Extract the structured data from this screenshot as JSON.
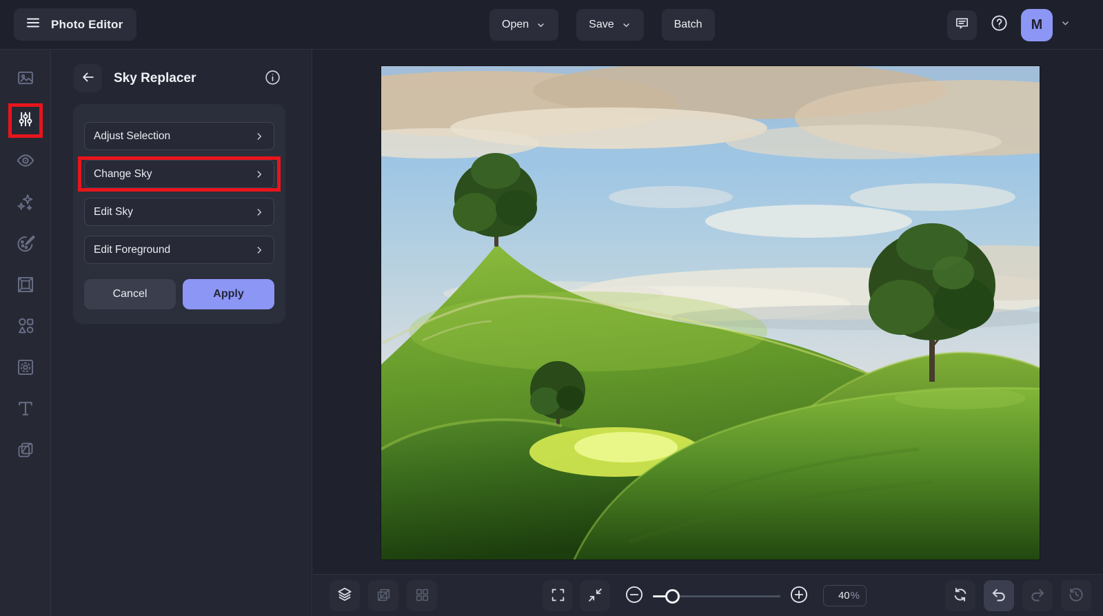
{
  "app": {
    "name": "Photo Editor"
  },
  "header": {
    "title": "Photo Editor",
    "menu_icon": "hamburger-icon",
    "open_label": "Open",
    "save_label": "Save",
    "batch_label": "Batch",
    "feedback_icon": "feedback-icon",
    "help_icon": "help-icon",
    "avatar_initial": "M",
    "account_caret_icon": "chevron-down-icon"
  },
  "sidebar": {
    "tools": [
      {
        "name": "photos",
        "icon": "image-icon",
        "active": false,
        "annotated": false
      },
      {
        "name": "adjustments",
        "icon": "sliders-icon",
        "active": true,
        "annotated": true
      },
      {
        "name": "preview",
        "icon": "eye-icon",
        "active": false,
        "annotated": false
      },
      {
        "name": "effects",
        "icon": "sparkles-icon",
        "active": false,
        "annotated": false
      },
      {
        "name": "color",
        "icon": "palette-icon",
        "active": false,
        "annotated": false
      },
      {
        "name": "frame",
        "icon": "frame-icon",
        "active": false,
        "annotated": false
      },
      {
        "name": "shapes",
        "icon": "shapes-icon",
        "active": false,
        "annotated": false
      },
      {
        "name": "mask",
        "icon": "mask-icon",
        "active": false,
        "annotated": false
      },
      {
        "name": "text",
        "icon": "text-icon",
        "active": false,
        "annotated": false
      },
      {
        "name": "blend",
        "icon": "blend-icon",
        "active": false,
        "annotated": false
      }
    ]
  },
  "panel": {
    "back_icon": "arrow-left-icon",
    "title": "Sky Replacer",
    "info_icon": "info-icon",
    "options": [
      {
        "label": "Adjust Selection",
        "annotated": false
      },
      {
        "label": "Change Sky",
        "annotated": true
      },
      {
        "label": "Edit Sky",
        "annotated": false
      },
      {
        "label": "Edit Foreground",
        "annotated": false
      }
    ],
    "cancel_label": "Cancel",
    "apply_label": "Apply"
  },
  "toolbar": {
    "left_tools": [
      {
        "name": "layers",
        "icon": "layers-icon",
        "enabled": true
      },
      {
        "name": "compare",
        "icon": "compare-icon",
        "enabled": false
      },
      {
        "name": "grid",
        "icon": "grid-icon",
        "enabled": false
      }
    ],
    "view_tools": [
      {
        "name": "fullscreen",
        "icon": "fullscreen-icon"
      },
      {
        "name": "fit-screen",
        "icon": "fit-screen-icon"
      }
    ],
    "zoom_out_icon": "minus-circle-icon",
    "zoom_in_icon": "plus-circle-icon",
    "slider_position_percent": 15,
    "zoom_value": "40",
    "zoom_unit": "%",
    "history_tools": [
      {
        "name": "rotate",
        "icon": "rotate-icon",
        "enabled": true,
        "highlighted": false
      },
      {
        "name": "undo",
        "icon": "undo-icon",
        "enabled": true,
        "highlighted": true
      },
      {
        "name": "redo",
        "icon": "redo-icon",
        "enabled": false,
        "highlighted": false
      },
      {
        "name": "history",
        "icon": "history-icon",
        "enabled": false,
        "highlighted": false
      }
    ]
  },
  "canvas": {
    "photo_alt": "Green rolling hills with three lone trees under a blue sky with cream clouds"
  },
  "annotations": {
    "color": "#e8151c",
    "highlighted_tool": "adjustments",
    "highlighted_option": "Change Sky"
  },
  "colors": {
    "accent": "#8c96f4",
    "annotation_red": "#e8151c"
  }
}
